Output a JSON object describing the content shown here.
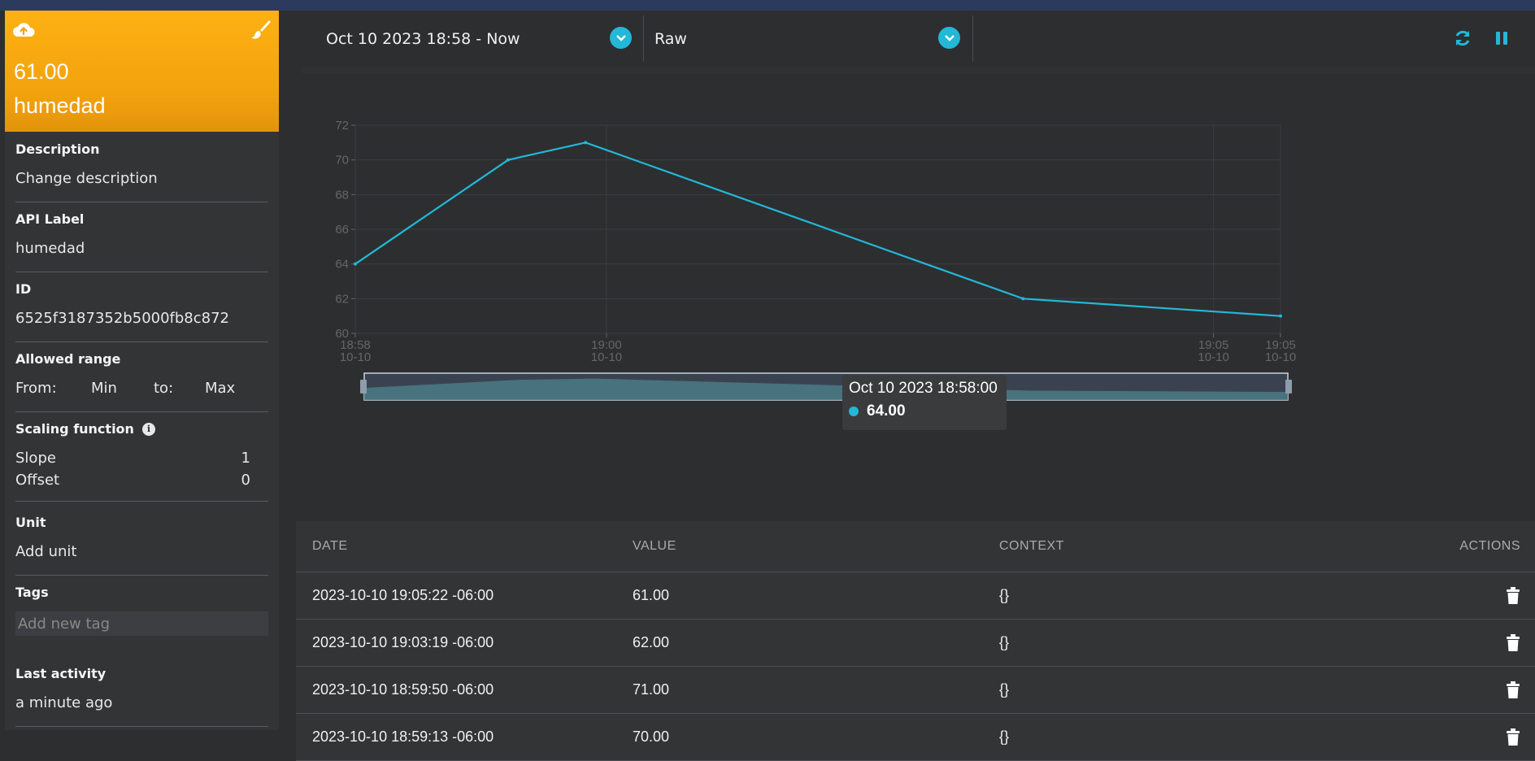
{
  "variable_card": {
    "value": "61.00",
    "name": "humedad",
    "upload_icon": "cloud-upload-icon",
    "edit_icon": "paint-brush-icon"
  },
  "details": {
    "description": {
      "title": "Description",
      "value": "Change description"
    },
    "api_label": {
      "title": "API Label",
      "value": "humedad"
    },
    "id": {
      "title": "ID",
      "value": "6525f3187352b5000fb8c872"
    },
    "allowed_range": {
      "title": "Allowed range",
      "from_label": "From:",
      "from_value": "Min",
      "to_label": "to:",
      "to_value": "Max"
    },
    "scaling": {
      "title": "Scaling function",
      "slope_label": "Slope",
      "slope_value": "1",
      "offset_label": "Offset",
      "offset_value": "0"
    },
    "unit": {
      "title": "Unit",
      "value": "Add unit"
    },
    "tags": {
      "title": "Tags",
      "placeholder": "Add new tag"
    },
    "last_activity": {
      "title": "Last activity",
      "value": "a minute ago"
    }
  },
  "toolbar": {
    "date_range": "Oct 10 2023 18:58 - Now",
    "aggregation": "Raw",
    "refresh_icon": "refresh-icon",
    "pause_icon": "pause-icon",
    "accent": "#22b8d8"
  },
  "chart_data": {
    "type": "line",
    "series": [
      {
        "name": "humedad",
        "x": [
          "2023-10-10 18:58:00",
          "2023-10-10 18:59:13",
          "2023-10-10 18:59:50",
          "2023-10-10 19:03:19",
          "2023-10-10 19:05:22"
        ],
        "values": [
          64,
          70,
          71,
          62,
          61
        ]
      }
    ],
    "ylim": [
      60,
      72
    ],
    "yticks": [
      "60",
      "62",
      "64",
      "66",
      "68",
      "70",
      "72"
    ],
    "xticks": [
      {
        "time": "18:58",
        "date": "10-10"
      },
      {
        "time": "19:00",
        "date": "10-10"
      },
      {
        "time": "19:05",
        "date": "10-10"
      },
      {
        "time": "19:05",
        "date": "10-10"
      }
    ],
    "grid": true,
    "line_color": "#22b8d8",
    "tooltip": {
      "title": "Oct 10 2023 18:58:00",
      "value": "64.00"
    }
  },
  "table": {
    "headers": [
      "DATE",
      "VALUE",
      "CONTEXT",
      "ACTIONS"
    ],
    "rows": [
      {
        "date": "2023-10-10 19:05:22 -06:00",
        "value": "61.00",
        "context": "{}"
      },
      {
        "date": "2023-10-10 19:03:19 -06:00",
        "value": "62.00",
        "context": "{}"
      },
      {
        "date": "2023-10-10 18:59:50 -06:00",
        "value": "71.00",
        "context": "{}"
      },
      {
        "date": "2023-10-10 18:59:13 -06:00",
        "value": "70.00",
        "context": "{}"
      }
    ],
    "delete_icon": "trash-icon"
  }
}
